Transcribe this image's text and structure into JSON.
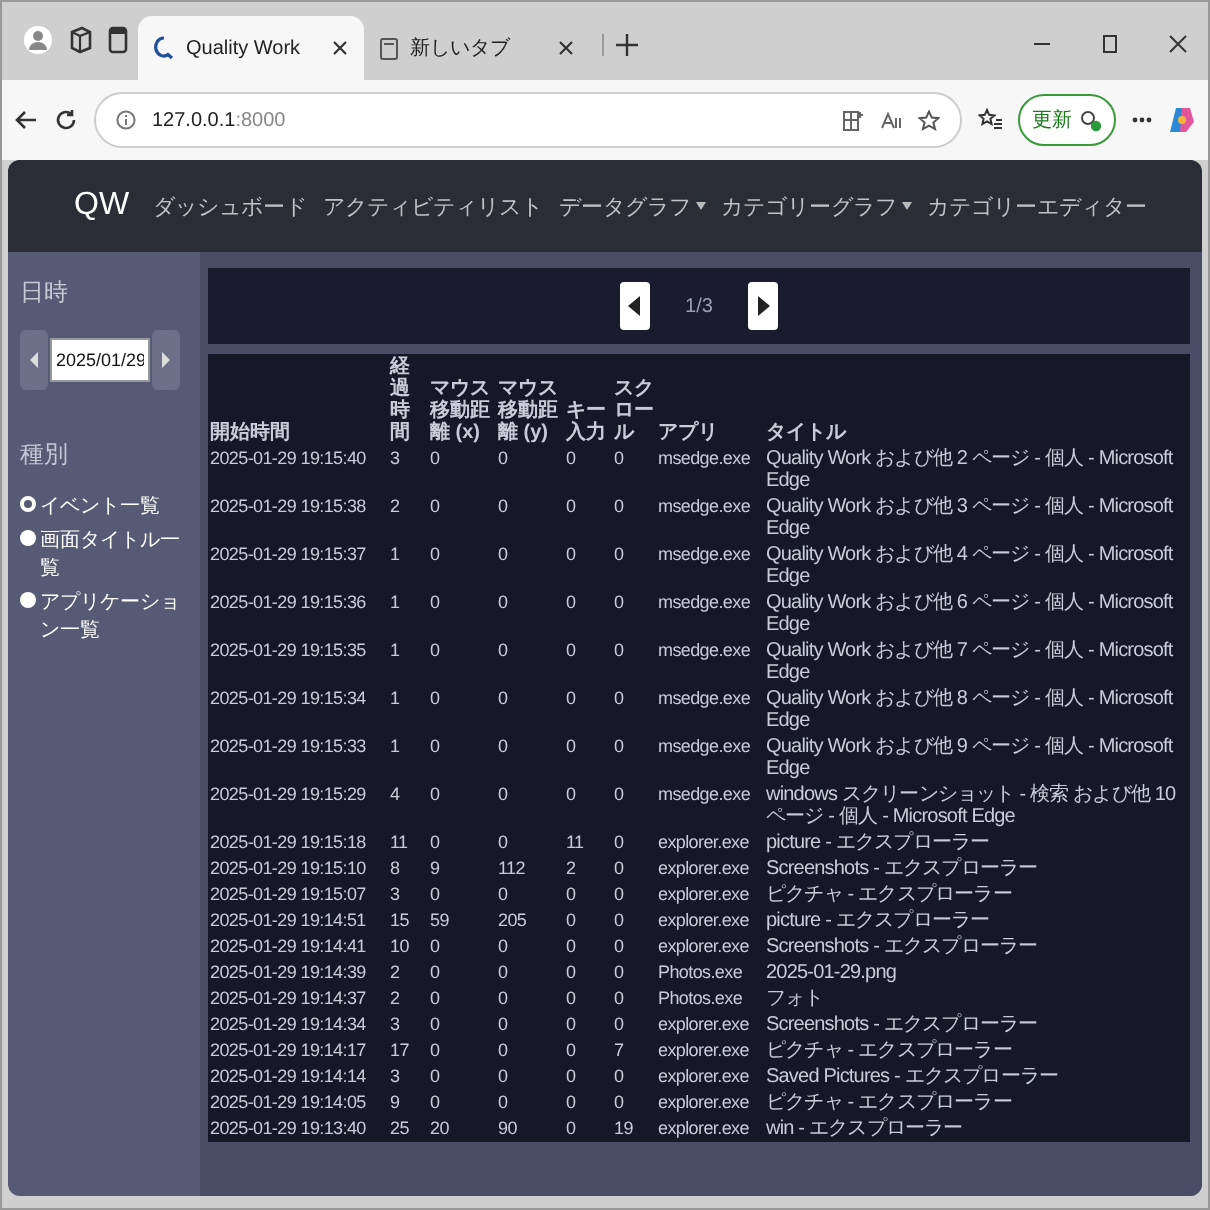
{
  "browser": {
    "tabs": [
      {
        "title": "Quality Work",
        "selected": true
      },
      {
        "title": "新しいタブ",
        "selected": false
      }
    ],
    "address": {
      "host": "127.0.0.1",
      "port": ":8000"
    },
    "update_button": "更新"
  },
  "navbar": {
    "brand": "QW",
    "items": [
      {
        "label": "ダッシュボード",
        "dropdown": false
      },
      {
        "label": "アクティビティリスト",
        "dropdown": false
      },
      {
        "label": "データグラフ",
        "dropdown": true
      },
      {
        "label": "カテゴリーグラフ",
        "dropdown": true
      },
      {
        "label": "カテゴリーエディター",
        "dropdown": false
      }
    ]
  },
  "sidebar": {
    "date_heading": "日時",
    "date_value": "2025/01/29",
    "type_heading": "種別",
    "options": [
      {
        "label": "イベント一覧",
        "selected": true
      },
      {
        "label": "画面タイトル一覧",
        "selected": false
      },
      {
        "label": "アプリケーション一覧",
        "selected": false
      }
    ]
  },
  "pager": {
    "page": "1/3"
  },
  "table": {
    "columns": [
      "開始時間",
      "経過時間",
      "マウス移動距離 (x)",
      "マウス移動距離 (y)",
      "キー入力",
      "スクロール",
      "アプリ",
      "タイトル"
    ],
    "rows": [
      [
        "2025-01-29 19:15:40",
        "3",
        "0",
        "0",
        "0",
        "0",
        "msedge.exe",
        "Quality Work および他 2 ページ - 個人 - Microsoft Edge"
      ],
      [
        "2025-01-29 19:15:38",
        "2",
        "0",
        "0",
        "0",
        "0",
        "msedge.exe",
        "Quality Work および他 3 ページ - 個人 - Microsoft Edge"
      ],
      [
        "2025-01-29 19:15:37",
        "1",
        "0",
        "0",
        "0",
        "0",
        "msedge.exe",
        "Quality Work および他 4 ページ - 個人 - Microsoft Edge"
      ],
      [
        "2025-01-29 19:15:36",
        "1",
        "0",
        "0",
        "0",
        "0",
        "msedge.exe",
        "Quality Work および他 6 ページ - 個人 - Microsoft Edge"
      ],
      [
        "2025-01-29 19:15:35",
        "1",
        "0",
        "0",
        "0",
        "0",
        "msedge.exe",
        "Quality Work および他 7 ページ - 個人 - Microsoft Edge"
      ],
      [
        "2025-01-29 19:15:34",
        "1",
        "0",
        "0",
        "0",
        "0",
        "msedge.exe",
        "Quality Work および他 8 ページ - 個人 - Microsoft Edge"
      ],
      [
        "2025-01-29 19:15:33",
        "1",
        "0",
        "0",
        "0",
        "0",
        "msedge.exe",
        "Quality Work および他 9 ページ - 個人 - Microsoft Edge"
      ],
      [
        "2025-01-29 19:15:29",
        "4",
        "0",
        "0",
        "0",
        "0",
        "msedge.exe",
        "windows スクリーンショット - 検索 および他 10 ページ - 個人 - Microsoft Edge"
      ],
      [
        "2025-01-29 19:15:18",
        "11",
        "0",
        "0",
        "11",
        "0",
        "explorer.exe",
        "picture - エクスプローラー"
      ],
      [
        "2025-01-29 19:15:10",
        "8",
        "9",
        "112",
        "2",
        "0",
        "explorer.exe",
        "Screenshots - エクスプローラー"
      ],
      [
        "2025-01-29 19:15:07",
        "3",
        "0",
        "0",
        "0",
        "0",
        "explorer.exe",
        "ピクチャ - エクスプローラー"
      ],
      [
        "2025-01-29 19:14:51",
        "15",
        "59",
        "205",
        "0",
        "0",
        "explorer.exe",
        "picture - エクスプローラー"
      ],
      [
        "2025-01-29 19:14:41",
        "10",
        "0",
        "0",
        "0",
        "0",
        "explorer.exe",
        "Screenshots - エクスプローラー"
      ],
      [
        "2025-01-29 19:14:39",
        "2",
        "0",
        "0",
        "0",
        "0",
        "Photos.exe",
        "2025-01-29.png"
      ],
      [
        "2025-01-29 19:14:37",
        "2",
        "0",
        "0",
        "0",
        "0",
        "Photos.exe",
        "フォト"
      ],
      [
        "2025-01-29 19:14:34",
        "3",
        "0",
        "0",
        "0",
        "0",
        "explorer.exe",
        "Screenshots - エクスプローラー"
      ],
      [
        "2025-01-29 19:14:17",
        "17",
        "0",
        "0",
        "0",
        "7",
        "explorer.exe",
        "ピクチャ - エクスプローラー"
      ],
      [
        "2025-01-29 19:14:14",
        "3",
        "0",
        "0",
        "0",
        "0",
        "explorer.exe",
        "Saved Pictures - エクスプローラー"
      ],
      [
        "2025-01-29 19:14:05",
        "9",
        "0",
        "0",
        "0",
        "0",
        "explorer.exe",
        "ピクチャ - エクスプローラー"
      ],
      [
        "2025-01-29 19:13:40",
        "25",
        "20",
        "90",
        "0",
        "19",
        "explorer.exe",
        "win - エクスプローラー"
      ]
    ]
  }
}
